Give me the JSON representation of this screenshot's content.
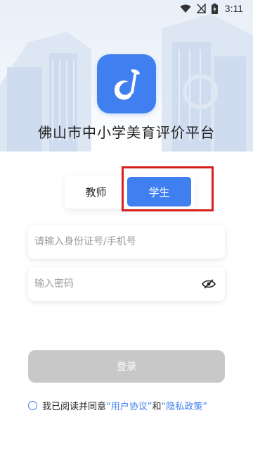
{
  "status_bar": {
    "time": "3:11",
    "icons": [
      "wifi-icon",
      "signal-off-icon",
      "battery-charging-icon"
    ]
  },
  "app": {
    "logo_icon": "music-note-leaf-logo",
    "title": "佛山市中小学美育评价平台",
    "accent_color": "#3f7ff0"
  },
  "role_switch": {
    "teacher_label": "教师",
    "student_label": "学生",
    "selected": "学生"
  },
  "form": {
    "account_placeholder": "请输入身份证号/手机号",
    "password_placeholder": "输入密码",
    "password_toggle_icon": "eye-off-icon",
    "login_label": "登录"
  },
  "agreement": {
    "prefix": "我已阅读并同意",
    "user_agreement": "“用户协议”",
    "conjunction": "和",
    "privacy_policy": "“隐私政策”"
  }
}
